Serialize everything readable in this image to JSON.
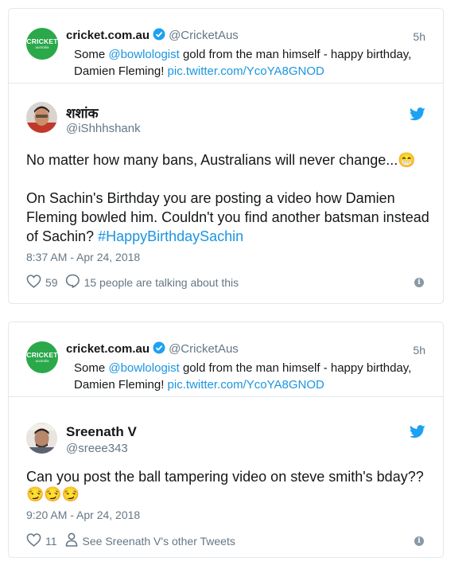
{
  "tweet1": {
    "quoted": {
      "logo_text": "CRICKET",
      "logo_subtext": "australia",
      "name": "cricket.com.au",
      "handle": "@CricketAus",
      "time": "5h",
      "text_prefix": "Some ",
      "mention": "@bowlologist",
      "text_middle": " gold from the man himself - happy birthday, Damien Fleming! ",
      "link": "pic.twitter.com/YcoYA8GNOD"
    },
    "reply": {
      "name": "शशांक",
      "handle": "@iShhhshank",
      "line1": "No matter how many bans, Australians will never change...",
      "line1_emoji": "😁",
      "line2": "On Sachin's Birthday you are posting a video how Damien Fleming bowled him. Couldn't you find another batsman instead of Sachin? ",
      "hashtag": "#HappyBirthdaySachin",
      "timestamp": "8:37 AM - Apr 24, 2018",
      "likes": "59",
      "talking": "15 people are talking about this"
    }
  },
  "tweet2": {
    "quoted": {
      "logo_text": "CRICKET",
      "logo_subtext": "australia",
      "name": "cricket.com.au",
      "handle": "@CricketAus",
      "time": "5h",
      "text_prefix": "Some ",
      "mention": "@bowlologist",
      "text_middle": " gold from the man himself - happy birthday, Damien Fleming! ",
      "link": "pic.twitter.com/YcoYA8GNOD"
    },
    "reply": {
      "name": "Sreenath V",
      "handle": "@sreee343",
      "line1": "Can you post the ball tampering video on steve smith's bday??",
      "emojis": "😏😏😏",
      "timestamp": "9:20 AM - Apr 24, 2018",
      "likes": "11",
      "other_tweets": "See Sreenath V's other Tweets"
    }
  },
  "colors": {
    "link_blue": "#1b95e0",
    "muted_gray": "#657786",
    "border": "#e1e8ed",
    "cricket_green": "#2aa84a"
  }
}
